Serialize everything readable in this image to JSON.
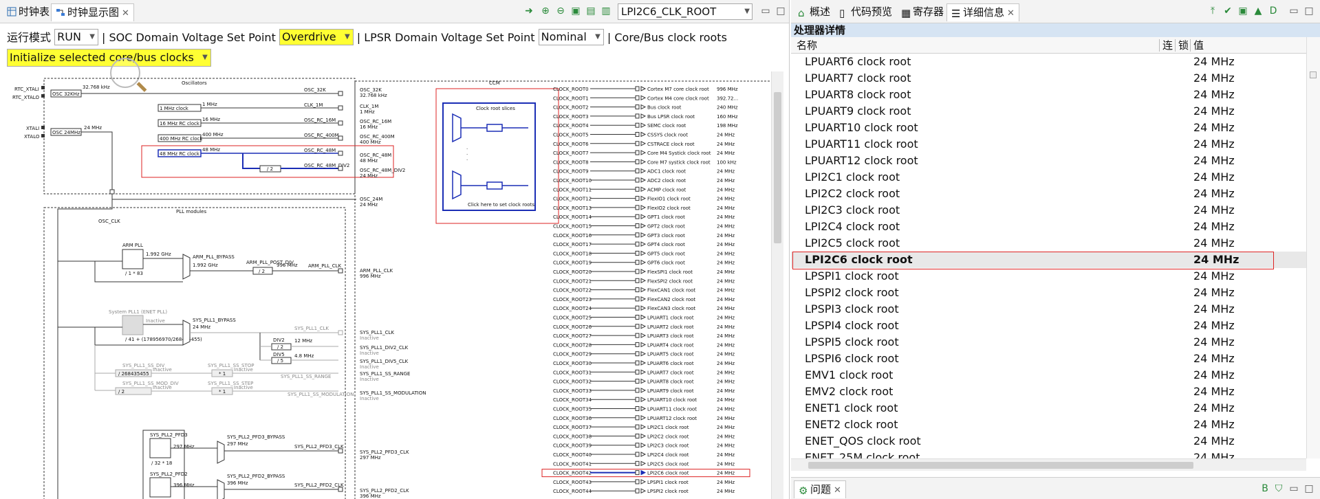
{
  "left_tabs": [
    {
      "label": "时钟表"
    },
    {
      "label": "时钟显示图"
    }
  ],
  "toolbar": {
    "root_combo": "LPI2C6_CLK_ROOT"
  },
  "options": {
    "run_mode_label": "运行模式",
    "run_mode_value": "RUN",
    "soc_label": "| SOC Domain Voltage Set Point",
    "soc_value": "Overdrive",
    "lpsr_label": "| LPSR Domain Voltage Set Point",
    "lpsr_value": "Nominal",
    "roots_label": "| Core/Bus clock roots",
    "init_button": "Initialize selected core/bus clocks"
  },
  "diagram": {
    "osc_title": "Oscillators",
    "ccm_title": "CCM",
    "pll_title": "PLL modules",
    "osc_clk": "OSC_CLK",
    "rtc_xtali": "RTC_XTALI",
    "rtc_xtalo": "RTC_XTALO",
    "xtali": "XTALI",
    "xtalo": "XTALO",
    "osc_32k_box": "OSC 32KHz",
    "osc_32k_freq": "32.768 kHz",
    "osc_24m_box": "OSC 24MHz",
    "osc_24m_freq": "24 MHz",
    "rc1m": "1 MHz clock",
    "rc1m_freq": "1 MHz",
    "rc16m": "16 MHz RC clock",
    "rc16m_freq": "16 MHz",
    "rc400m": "400 MHz RC clock",
    "rc400m_freq": "400 MHz",
    "rc48m": "48 MHz RC clock",
    "rc48m_freq": "48 MHz",
    "div2": "/ 2",
    "sig_32k": "OSC_32K",
    "sig_1m": "CLK_1M",
    "sig_16m": "OSC_RC_16M",
    "sig_400m": "OSC_RC_400M",
    "sig_48m": "OSC_RC_48M",
    "sig_48m_div2": "OSC_RC_48M_DIV2",
    "out_32k": "OSC_32K",
    "out_32k_f": "32.768 kHz",
    "out_1m": "CLK_1M",
    "out_1m_f": "1 MHz",
    "out_16m": "OSC_RC_16M",
    "out_16m_f": "16 MHz",
    "out_400m": "OSC_RC_400M",
    "out_400m_f": "400 MHz",
    "out_48m": "OSC_RC_48M",
    "out_48m_f": "48 MHz",
    "out_48m_div2": "OSC_RC_48M_DIV2",
    "out_48m_div2_f": "24 MHz",
    "out_24m": "OSC_24M",
    "out_24m_f": "24 MHz",
    "slices_title": "Clock root slices",
    "slices_link": "Click here to set clock roots",
    "arm_pll": "ARM PLL",
    "arm_pll_freq": "1.992 GHz",
    "arm_pll_div": "/ 1 * 83",
    "arm_pll_bypass": "ARM_PLL_BYPASS",
    "arm_pll_bypass_f": "1.992 GHz",
    "arm_pll_post_div": "ARM_PLL_POST_DIV",
    "arm_pll_post_f": "996 MHz",
    "arm_pll_clk": "ARM_PLL_CLK",
    "arm_pll_clk_out": "ARM_PLL_CLK",
    "arm_pll_clk_out_f": "996 MHz",
    "sys_pll1": "System PLL1 (ENET PLL)",
    "sys_pll1_state": "Inactive",
    "sys_pll1_div": "/ 41 + (178956970/268435455)",
    "sys_pll1_bypass": "SYS_PLL1_BYPASS",
    "sys_pll1_bypass_f": "24 MHz",
    "sys_pll1_clk": "SYS_PLL1_CLK",
    "sys_pll1_clk_out": "SYS_PLL1_CLK",
    "inactive": "Inactive",
    "div2_name": "DIV2",
    "div2_f": "12 MHz",
    "div5_name": "DIV5",
    "div5_f": "4.8 MHz",
    "div5_box": "/ 5",
    "sys_pll1_div2": "SYS_PLL1_DIV2_CLK",
    "sys_pll1_div5": "SYS_PLL1_DIV5_CLK",
    "ss_div": "SYS_PLL1_SS_DIV",
    "ss_div_box": "/ 268435455",
    "ss_stop": "SYS_PLL1_SS_STOP",
    "ss_stop_box": "* 1",
    "ss_range": "SYS_PLL1_SS_RANGE",
    "ss_mod_div": "SYS_PLL1_SS_MOD_DIV",
    "ss_mod_box": "/ 2",
    "ss_step": "SYS_PLL1_SS_STEP",
    "ss_step_box": "* 1",
    "ss_modulation": "SYS_PLL1_SS_MODULATION",
    "pfd3": "SYS_PLL2_PFD3",
    "pfd3_f": "297 MHz",
    "pfd3_div": "/ 32 * 18",
    "pfd3_bypass": "SYS_PLL2_PFD3_BYPASS",
    "pfd3_bypass_f": "297 MHz",
    "pfd3_clk": "SYS_PLL2_PFD3_CLK",
    "pfd3_clk_out": "SYS_PLL2_PFD3_CLK",
    "pfd3_clk_out_f": "297 MHz",
    "pfd2": "SYS_PLL2_PFD2",
    "pfd2_f": "396 MHz",
    "pfd2_bypass": "SYS_PLL2_PFD2_BYPASS",
    "pfd2_bypass_f": "396 MHz",
    "pfd2_clk": "SYS_PLL2_PFD2_CLK",
    "pfd2_clk_out": "SYS_PLL2_PFD2_CLK",
    "pfd2_clk_out_f": "396 MHz",
    "roots": [
      {
        "root": "CLOCK_ROOT0",
        "name": "Cortex M7 core clock root",
        "f": "996 MHz"
      },
      {
        "root": "CLOCK_ROOT1",
        "name": "Cortex M4 core clock root",
        "f": "392.72..."
      },
      {
        "root": "CLOCK_ROOT2",
        "name": "Bus clock root",
        "f": "240 MHz"
      },
      {
        "root": "CLOCK_ROOT3",
        "name": "Bus LPSR clock root",
        "f": "160 MHz"
      },
      {
        "root": "CLOCK_ROOT4",
        "name": "SEMC clock root",
        "f": "198 MHz"
      },
      {
        "root": "CLOCK_ROOT5",
        "name": "CSSYS clock root",
        "f": "24 MHz"
      },
      {
        "root": "CLOCK_ROOT6",
        "name": "CSTRACE clock root",
        "f": "24 MHz"
      },
      {
        "root": "CLOCK_ROOT7",
        "name": "Core M4 Systick clock root",
        "f": "24 MHz"
      },
      {
        "root": "CLOCK_ROOT8",
        "name": "Core M7 systick clock root",
        "f": "100 kHz"
      },
      {
        "root": "CLOCK_ROOT9",
        "name": "ADC1 clock root",
        "f": "24 MHz"
      },
      {
        "root": "CLOCK_ROOT10",
        "name": "ADC2 clock root",
        "f": "24 MHz"
      },
      {
        "root": "CLOCK_ROOT11",
        "name": "ACMP clock root",
        "f": "24 MHz"
      },
      {
        "root": "CLOCK_ROOT12",
        "name": "FlexIO1 clock root",
        "f": "24 MHz"
      },
      {
        "root": "CLOCK_ROOT13",
        "name": "FlexIO2 clock root",
        "f": "24 MHz"
      },
      {
        "root": "CLOCK_ROOT14",
        "name": "GPT1 clock root",
        "f": "24 MHz"
      },
      {
        "root": "CLOCK_ROOT15",
        "name": "GPT2 clock root",
        "f": "24 MHz"
      },
      {
        "root": "CLOCK_ROOT16",
        "name": "GPT3 clock root",
        "f": "24 MHz"
      },
      {
        "root": "CLOCK_ROOT17",
        "name": "GPT4 clock root",
        "f": "24 MHz"
      },
      {
        "root": "CLOCK_ROOT18",
        "name": "GPT5 clock root",
        "f": "24 MHz"
      },
      {
        "root": "CLOCK_ROOT19",
        "name": "GPT6 clock root",
        "f": "24 MHz"
      },
      {
        "root": "CLOCK_ROOT20",
        "name": "FlexSPI1 clock root",
        "f": "24 MHz"
      },
      {
        "root": "CLOCK_ROOT21",
        "name": "FlexSPI2 clock root",
        "f": "24 MHz"
      },
      {
        "root": "CLOCK_ROOT22",
        "name": "FlexCAN1 clock root",
        "f": "24 MHz"
      },
      {
        "root": "CLOCK_ROOT23",
        "name": "FlexCAN2 clock root",
        "f": "24 MHz"
      },
      {
        "root": "CLOCK_ROOT24",
        "name": "FlexCAN3 clock root",
        "f": "24 MHz"
      },
      {
        "root": "CLOCK_ROOT25",
        "name": "LPUART1 clock root",
        "f": "24 MHz"
      },
      {
        "root": "CLOCK_ROOT26",
        "name": "LPUART2 clock root",
        "f": "24 MHz"
      },
      {
        "root": "CLOCK_ROOT27",
        "name": "LPUART3 clock root",
        "f": "24 MHz"
      },
      {
        "root": "CLOCK_ROOT28",
        "name": "LPUART4 clock root",
        "f": "24 MHz"
      },
      {
        "root": "CLOCK_ROOT29",
        "name": "LPUART5 clock root",
        "f": "24 MHz"
      },
      {
        "root": "CLOCK_ROOT30",
        "name": "LPUART6 clock root",
        "f": "24 MHz"
      },
      {
        "root": "CLOCK_ROOT31",
        "name": "LPUART7 clock root",
        "f": "24 MHz"
      },
      {
        "root": "CLOCK_ROOT32",
        "name": "LPUART8 clock root",
        "f": "24 MHz"
      },
      {
        "root": "CLOCK_ROOT33",
        "name": "LPUART9 clock root",
        "f": "24 MHz"
      },
      {
        "root": "CLOCK_ROOT34",
        "name": "LPUART10 clock root",
        "f": "24 MHz"
      },
      {
        "root": "CLOCK_ROOT35",
        "name": "LPUART11 clock root",
        "f": "24 MHz"
      },
      {
        "root": "CLOCK_ROOT36",
        "name": "LPUART12 clock root",
        "f": "24 MHz"
      },
      {
        "root": "CLOCK_ROOT37",
        "name": "LPI2C1 clock root",
        "f": "24 MHz"
      },
      {
        "root": "CLOCK_ROOT38",
        "name": "LPI2C2 clock root",
        "f": "24 MHz"
      },
      {
        "root": "CLOCK_ROOT39",
        "name": "LPI2C3 clock root",
        "f": "24 MHz"
      },
      {
        "root": "CLOCK_ROOT40",
        "name": "LPI2C4 clock root",
        "f": "24 MHz"
      },
      {
        "root": "CLOCK_ROOT41",
        "name": "LPI2C5 clock root",
        "f": "24 MHz"
      },
      {
        "root": "CLOCK_ROOT42",
        "name": "LPI2C6 clock root",
        "f": "24 MHz",
        "selected": true
      },
      {
        "root": "CLOCK_ROOT43",
        "name": "LPSPI1 clock root",
        "f": "24 MHz"
      },
      {
        "root": "CLOCK_ROOT44",
        "name": "LPSPI2 clock root",
        "f": "24 MHz"
      }
    ]
  },
  "right_tabs": [
    {
      "label": "概述"
    },
    {
      "label": "代码预览"
    },
    {
      "label": "寄存器"
    },
    {
      "label": "详细信息"
    }
  ],
  "right_toolbar": {
    "d_label": "D"
  },
  "details": {
    "section": "处理器详情",
    "col_name": "名称",
    "col_link": "连",
    "col_lock": "锁",
    "col_value": "值",
    "rows": [
      {
        "name": "LPUART6 clock root",
        "value": "24 MHz"
      },
      {
        "name": "LPUART7 clock root",
        "value": "24 MHz"
      },
      {
        "name": "LPUART8 clock root",
        "value": "24 MHz"
      },
      {
        "name": "LPUART9 clock root",
        "value": "24 MHz"
      },
      {
        "name": "LPUART10 clock root",
        "value": "24 MHz"
      },
      {
        "name": "LPUART11 clock root",
        "value": "24 MHz"
      },
      {
        "name": "LPUART12 clock root",
        "value": "24 MHz"
      },
      {
        "name": "LPI2C1 clock root",
        "value": "24 MHz"
      },
      {
        "name": "LPI2C2 clock root",
        "value": "24 MHz"
      },
      {
        "name": "LPI2C3 clock root",
        "value": "24 MHz"
      },
      {
        "name": "LPI2C4 clock root",
        "value": "24 MHz"
      },
      {
        "name": "LPI2C5 clock root",
        "value": "24 MHz"
      },
      {
        "name": "LPI2C6 clock root",
        "value": "24 MHz",
        "selected": true
      },
      {
        "name": "LPSPI1 clock root",
        "value": "24 MHz"
      },
      {
        "name": "LPSPI2 clock root",
        "value": "24 MHz"
      },
      {
        "name": "LPSPI3 clock root",
        "value": "24 MHz"
      },
      {
        "name": "LPSPI4 clock root",
        "value": "24 MHz"
      },
      {
        "name": "LPSPI5 clock root",
        "value": "24 MHz"
      },
      {
        "name": "LPSPI6 clock root",
        "value": "24 MHz"
      },
      {
        "name": "EMV1 clock root",
        "value": "24 MHz"
      },
      {
        "name": "EMV2 clock root",
        "value": "24 MHz"
      },
      {
        "name": "ENET1 clock root",
        "value": "24 MHz"
      },
      {
        "name": "ENET2 clock root",
        "value": "24 MHz"
      },
      {
        "name": "ENET_QOS clock root",
        "value": "24 MHz"
      },
      {
        "name": "ENET_25M clock root",
        "value": "24 MHz"
      }
    ]
  },
  "problems_tab": {
    "label": "问题"
  },
  "bottom_toolbar": {
    "b_label": "B"
  },
  "colors": {
    "accent": "#1a2db5",
    "highlight": "#ffff33",
    "selection_border": "#dd2222"
  }
}
